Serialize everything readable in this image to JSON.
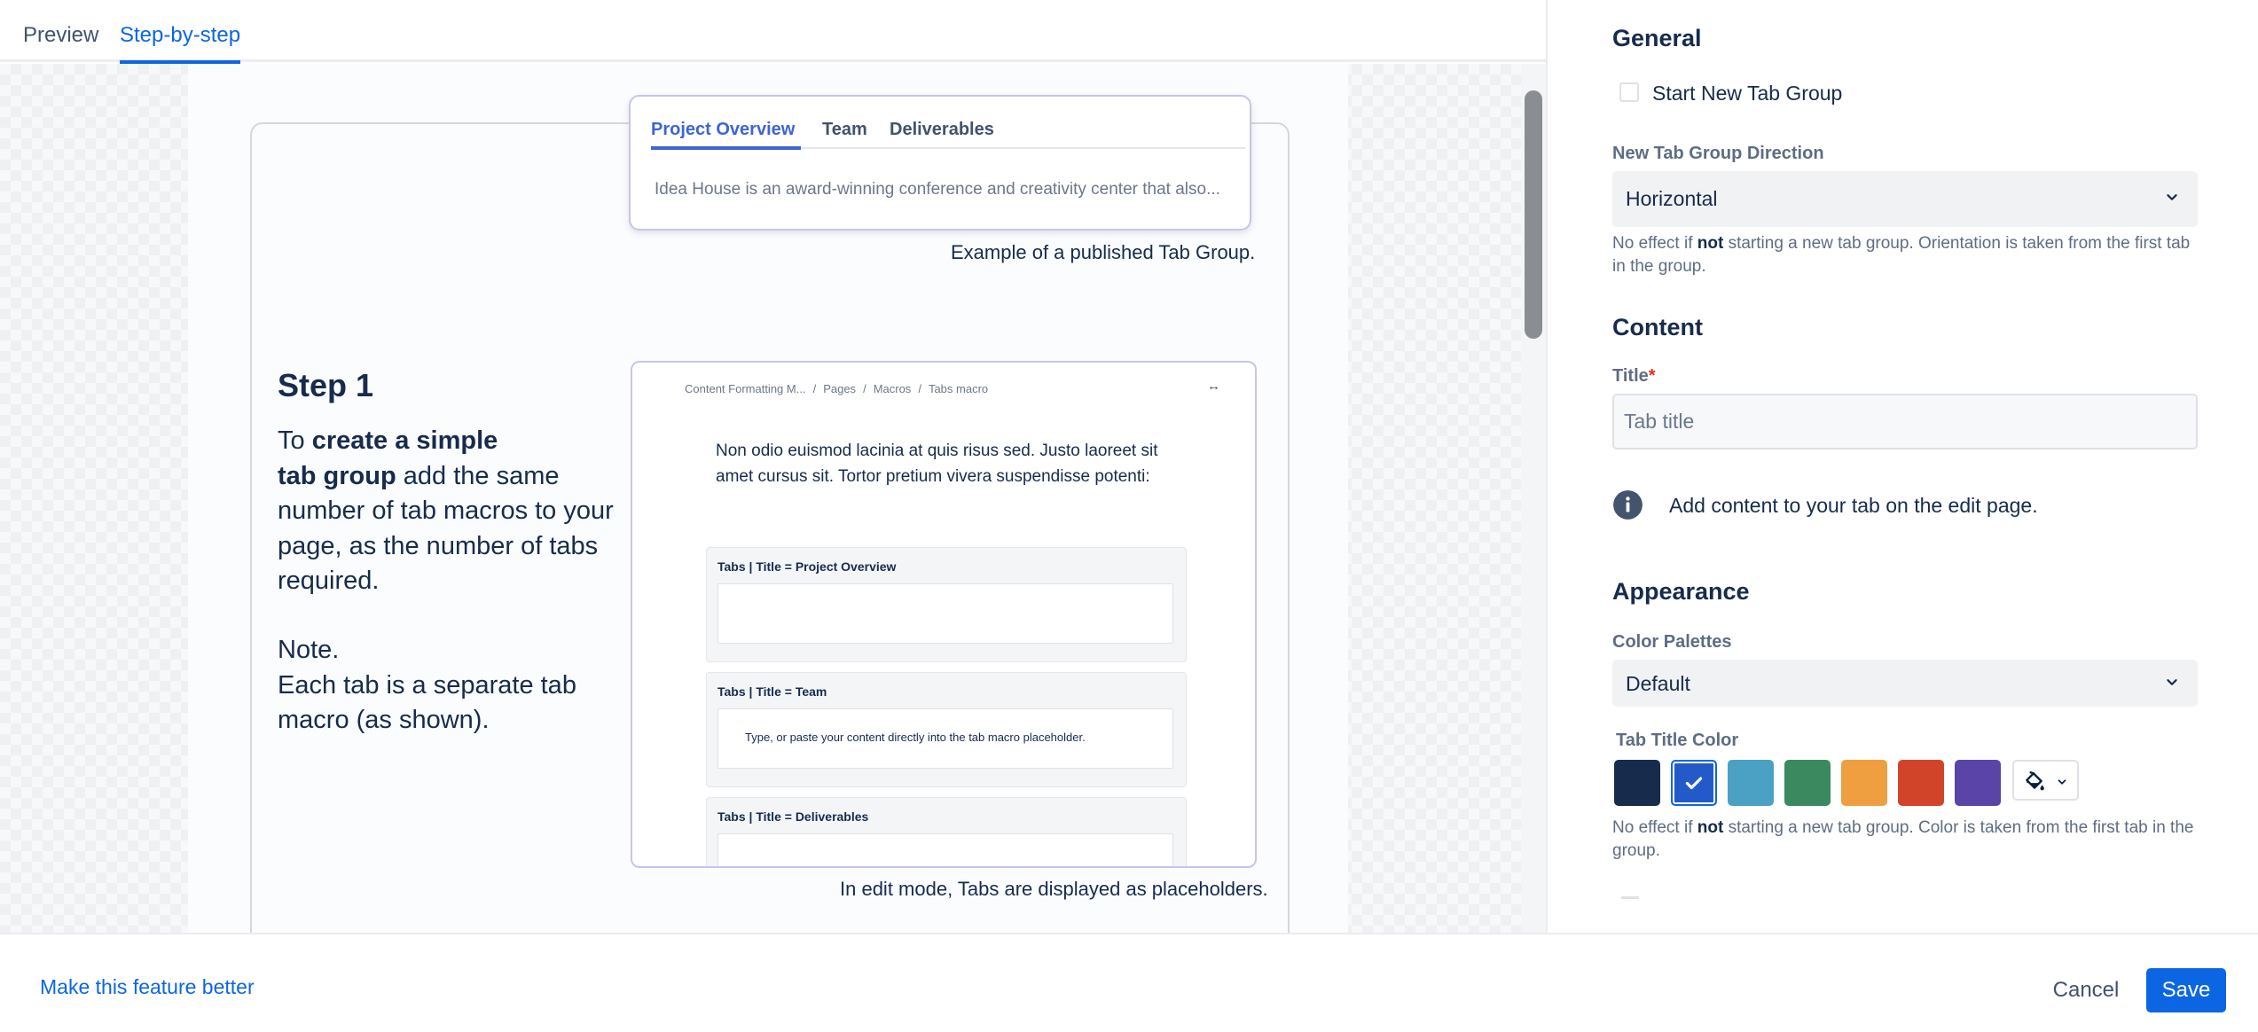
{
  "tabs": {
    "preview": "Preview",
    "step_by_step": "Step-by-step"
  },
  "illustration": {
    "published_tabs": [
      "Project Overview",
      "Team",
      "Deliverables"
    ],
    "published_body": "Idea House is an award-winning conference and creativity center that also...",
    "published_caption": "Example of a published Tab Group.",
    "step_title": "Step 1",
    "step_text": {
      "prefix": "To ",
      "bold1": "create a simple",
      "bold2": "tab group",
      "rest": " add the same number of tab macros to your page, as the number of tabs required."
    },
    "note_title": "Note.",
    "note_body": "Each tab is a separate tab macro (as shown).",
    "breadcrumbs": [
      "Content Formatting M...",
      "Pages",
      "Macros",
      "Tabs macro"
    ],
    "edit_paragraph": "Non odio euismod lacinia at quis risus sed. Justo laoreet sit amet cursus sit. Tortor pretium vivera suspendisse potenti:",
    "placeholders": [
      {
        "title": "Tabs | Title = Project Overview",
        "content": ""
      },
      {
        "title": "Tabs | Title = Team",
        "content": "Type, or paste your content directly into the tab macro placeholder."
      },
      {
        "title": "Tabs | Title = Deliverables",
        "content": ""
      }
    ],
    "edit_caption": "In edit mode, Tabs are displayed as placeholders."
  },
  "panel": {
    "general": {
      "heading": "General",
      "start_new_group_label": "Start New Tab Group",
      "start_new_group_checked": false,
      "direction_label": "New Tab Group Direction",
      "direction_value": "Horizontal",
      "direction_help_1": "No effect if ",
      "direction_help_bold": "not",
      "direction_help_2": " starting a new tab group. Orientation is taken from the first tab in the group."
    },
    "content": {
      "heading": "Content",
      "title_label": "Title",
      "title_required_mark": "*",
      "title_placeholder": "Tab title",
      "title_value": "",
      "info_text": "Add content to your tab on the edit page.",
      "info_icon": "info-icon"
    },
    "appearance": {
      "heading": "Appearance",
      "palettes_label": "Color Palettes",
      "palettes_value": "Default",
      "title_color_label": "Tab Title Color",
      "swatches": [
        "#172b4d",
        "#2459c9",
        "#4aa1c3",
        "#3b8a5f",
        "#ef9f40",
        "#d2442a",
        "#5b44a7"
      ],
      "selected_swatch_index": 1,
      "custom_color_icon": "paint-bucket-icon",
      "color_help_1": "No effect if ",
      "color_help_bold": "not",
      "color_help_2": " starting a new tab group. Color is taken from the first tab in the group."
    }
  },
  "footer": {
    "feedback_link": "Make this feature better",
    "cancel": "Cancel",
    "save": "Save"
  }
}
